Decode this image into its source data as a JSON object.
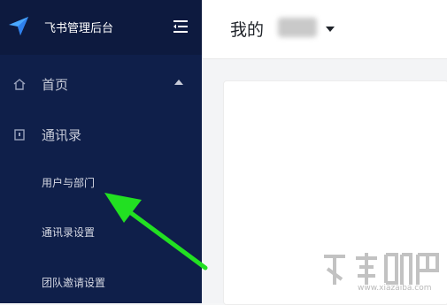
{
  "app": {
    "title": "飞书管理后台"
  },
  "sidebar": {
    "items": [
      {
        "label": "首页",
        "icon": "home-icon",
        "expanded": true
      },
      {
        "label": "通讯录",
        "icon": "contacts-icon",
        "expanded": true,
        "children": [
          {
            "label": "用户与部门"
          },
          {
            "label": "通讯录设置"
          },
          {
            "label": "团队邀请设置"
          }
        ]
      }
    ]
  },
  "header": {
    "title": "我的"
  },
  "annotation": {
    "color": "#22e022"
  },
  "watermark": {
    "url": "www.xiazaiba.com"
  },
  "colors": {
    "sidebar_bg": "#0f1f4a",
    "header_bg": "#0d1a3f",
    "accent": "#4a90ff"
  }
}
